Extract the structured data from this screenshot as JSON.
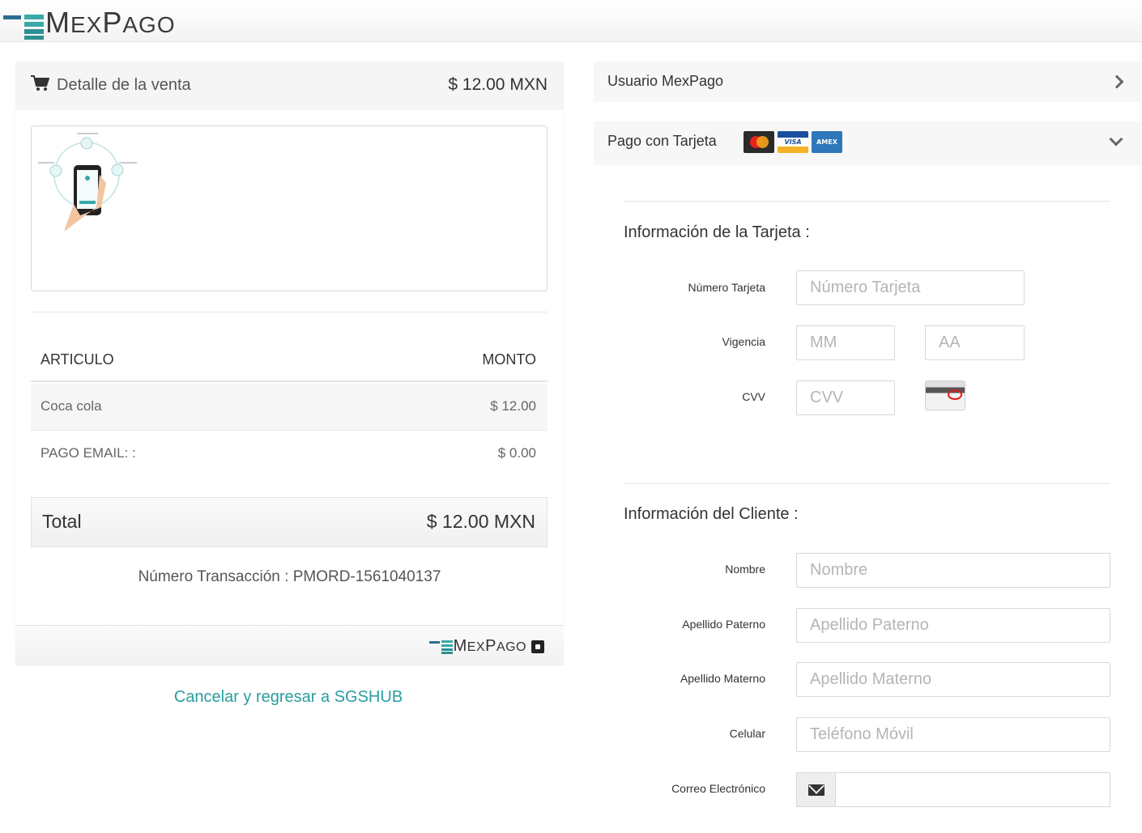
{
  "brand": {
    "name_first": "M",
    "name_rest1": "EX",
    "name_mid": "P",
    "name_rest2": "AGO"
  },
  "sale": {
    "title": "Detalle de la venta",
    "amount": "$ 12.00 MXN",
    "table": {
      "col_item": "ARTICULO",
      "col_amount": "MONTO",
      "rows": [
        {
          "item": "Coca cola",
          "amount": "$ 12.00"
        },
        {
          "item": "PAGO EMAIL: :",
          "amount": "$ 0.00"
        }
      ]
    },
    "total_label": "Total",
    "total_amount": "$ 12.00 MXN",
    "transaction": "Número Transacción : PMORD-1561040137",
    "cancel_link": "Cancelar y regresar a SGSHUB"
  },
  "payment": {
    "user_section": "Usuario MexPago",
    "card_section": "Pago con Tarjeta",
    "card_brands": [
      "mastercard",
      "visa",
      "amex"
    ],
    "card_info_title": "Información de la Tarjeta :",
    "card_number_label": "Número Tarjeta",
    "card_number_placeholder": "Número Tarjeta",
    "expiry_label": "Vigencia",
    "month_placeholder": "MM",
    "year_placeholder": "AA",
    "cvv_label": "CVV",
    "cvv_placeholder": "CVV",
    "client_info_title": "Información del Cliente :",
    "name_label": "Nombre",
    "name_placeholder": "Nombre",
    "lastname1_label": "Apellido Paterno",
    "lastname1_placeholder": "Apellido Paterno",
    "lastname2_label": "Apellido Materno",
    "lastname2_placeholder": "Apellido Materno",
    "phone_label": "Celular",
    "phone_placeholder": "Teléfono Móvil",
    "email_label": "Correo Electrónico",
    "email_placeholder": ""
  },
  "colors": {
    "brand_teal": "#2a9d9f",
    "brand_dark": "#3a3a3a"
  }
}
